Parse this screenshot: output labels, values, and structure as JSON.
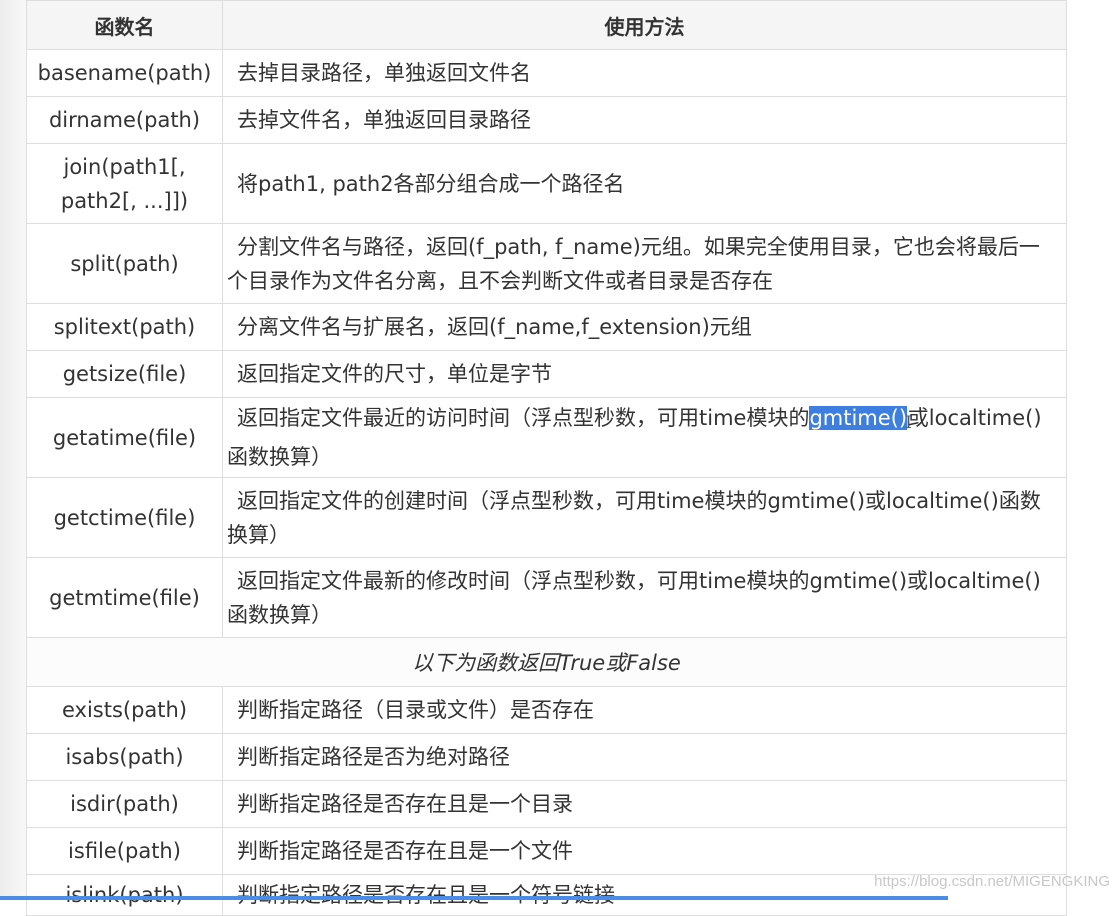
{
  "table": {
    "headers": [
      "函数名",
      "使用方法"
    ],
    "rows": [
      {
        "fn": "basename(path)",
        "desc": "去掉目录路径，单独返回文件名"
      },
      {
        "fn": "dirname(path)",
        "desc": "去掉文件名，单独返回目录路径"
      },
      {
        "fn": "join(path1[, path2[, ...]])",
        "desc": "将path1, path2各部分组合成一个路径名"
      },
      {
        "fn": "split(path)",
        "desc": "分割文件名与路径，返回(f_path, f_name)元组。如果完全使用目录，它也会将最后一个目录作为文件名分离，且不会判断文件或者目录是否存在"
      },
      {
        "fn": "splitext(path)",
        "desc": "分离文件名与扩展名，返回(f_name,f_extension)元组"
      },
      {
        "fn": "getsize(file)",
        "desc": "返回指定文件的尺寸，单位是字节"
      },
      {
        "fn": "getatime(file)",
        "desc_before": "返回指定文件最近的访问时间（浮点型秒数，可用time模块的",
        "desc_selected": "gmtime()",
        "desc_after": "或localtime()函数换算）"
      },
      {
        "fn": "getctime(file)",
        "desc": "返回指定文件的创建时间（浮点型秒数，可用time模块的gmtime()或localtime()函数换算）"
      },
      {
        "fn": "getmtime(file)",
        "desc": "返回指定文件最新的修改时间（浮点型秒数，可用time模块的gmtime()或localtime()函数换算）"
      }
    ],
    "section_label": "以下为函数返回True或False",
    "bool_rows": [
      {
        "fn": "exists(path)",
        "desc": "判断指定路径（目录或文件）是否存在"
      },
      {
        "fn": "isabs(path)",
        "desc": "判断指定路径是否为绝对路径"
      },
      {
        "fn": "isdir(path)",
        "desc": "判断指定路径是否存在且是一个目录"
      },
      {
        "fn": "isfile(path)",
        "desc": "判断指定路径是否存在且是一个文件"
      },
      {
        "fn": "islink(path)",
        "desc": "判断指定路径是否存在且是一个符号链接"
      }
    ]
  },
  "watermark": "https://blog.csdn.net/MIGENGKING",
  "colors": {
    "selection": "#3d7fe0",
    "header_bg": "#f5f5f5",
    "border": "#dedede",
    "bottom_bar": "#4b8de6"
  }
}
